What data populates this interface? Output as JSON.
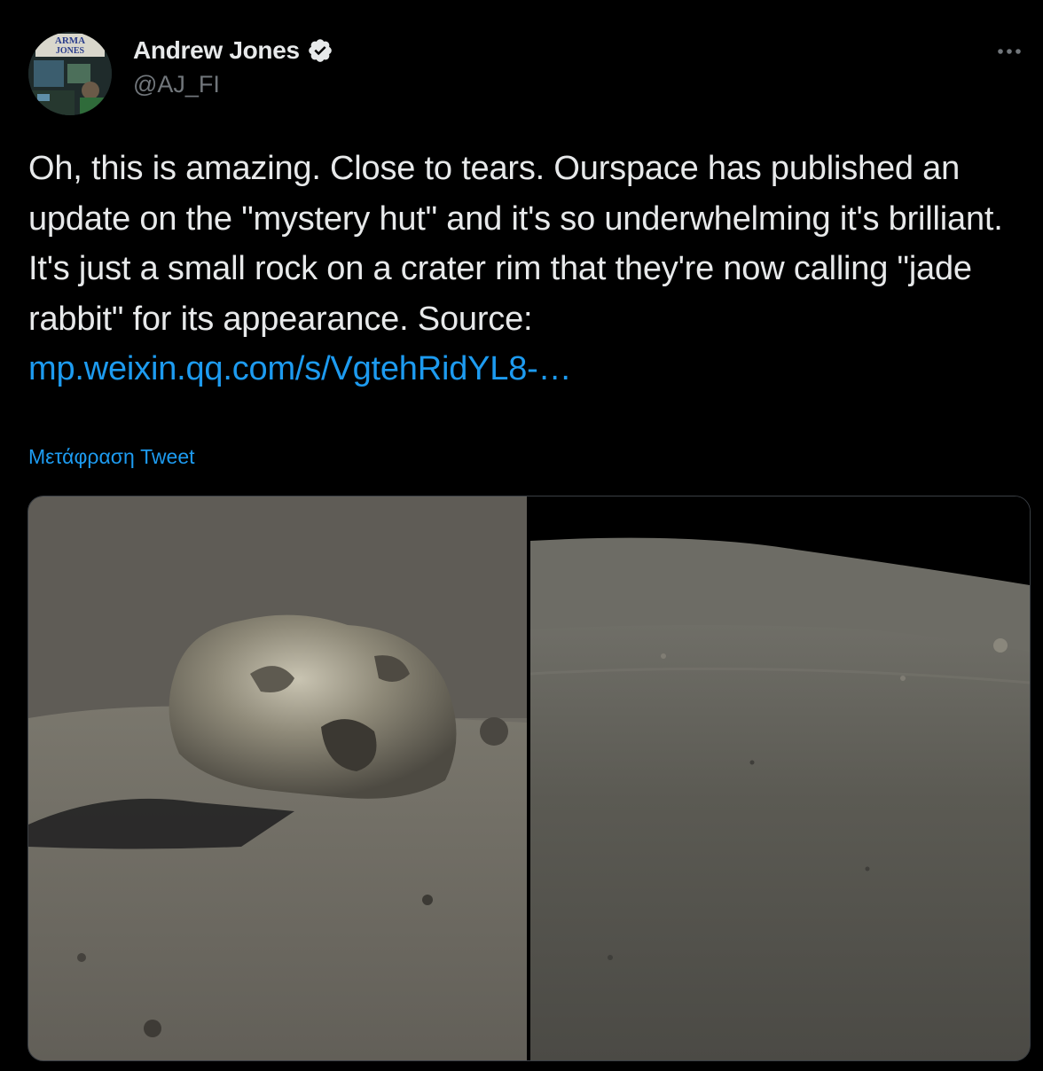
{
  "author": {
    "display_name": "Andrew Jones",
    "handle": "@AJ_FI",
    "verified": true,
    "avatar_text": [
      "ARMA",
      "JONES"
    ]
  },
  "tweet": {
    "text": "Oh, this is amazing. Close to tears. Ourspace has published an update on the \"mystery hut\" and it's so underwhelming it's brilliant. It's just a small rock on a crater rim that they're now calling \"jade rabbit\" for its appearance. Source:",
    "link_text": "mp.weixin.qq.com/s/VgtehRidYL8-…",
    "translate_label": "Μετάφραση Tweet"
  },
  "icons": {
    "verified": "verified-badge-icon",
    "more": "more-options-icon"
  },
  "colors": {
    "background": "#000000",
    "text_primary": "#e7e9ea",
    "text_secondary": "#71767b",
    "link": "#1d9bf0",
    "border": "#3a3f44"
  }
}
